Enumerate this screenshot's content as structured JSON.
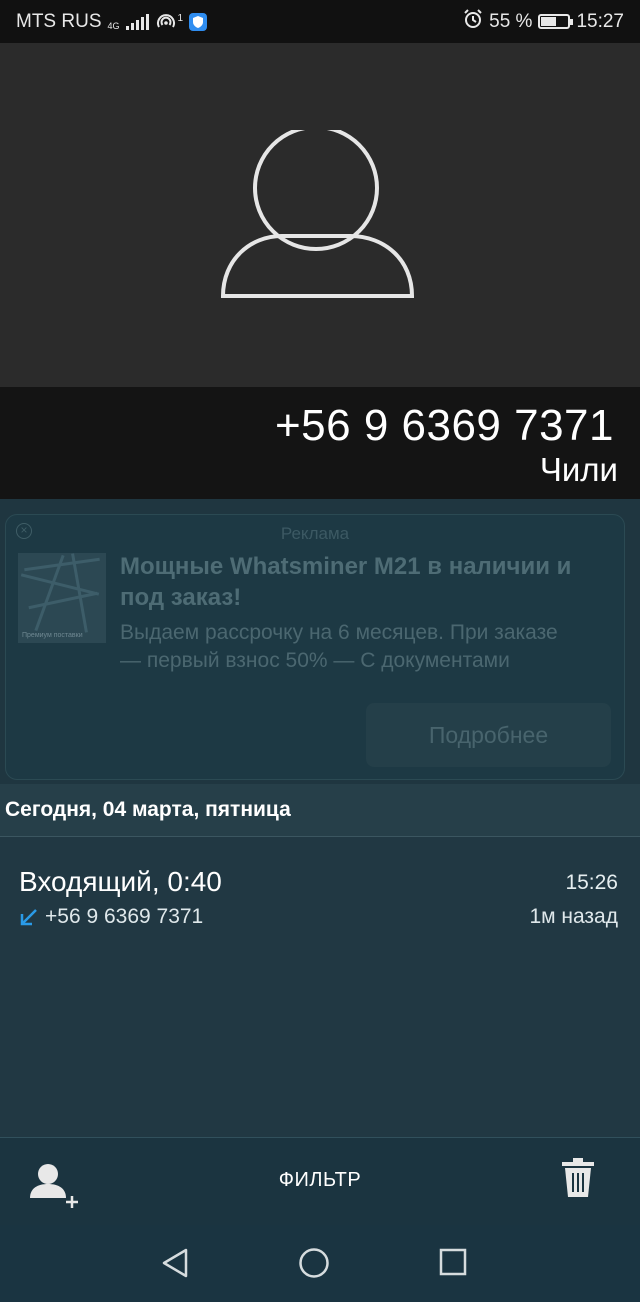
{
  "status_bar": {
    "carrier": "MTS RUS",
    "network": "4G",
    "hotspot_count": "1",
    "battery": "55 %",
    "battery_level": 0.55,
    "time": "15:27"
  },
  "contact": {
    "avatar_icon": "person-placeholder-icon",
    "phone": "+56 9 6369 7371",
    "location": "Чили"
  },
  "ad": {
    "label": "Реклама",
    "title": "Мощные Whatsminer M21 в наличии и под заказ!",
    "text": "Выдаем рассрочку на 6 месяцев. При заказе — первый взнос 50% — С документами",
    "image_caption": "Премиум поставки",
    "button": "Подробнее"
  },
  "call_log": {
    "date_header": "Сегодня, 04 марта, пятница",
    "entries": [
      {
        "type": "Входящий, 0:40",
        "number": "+56 9 6369 7371",
        "time": "15:26",
        "ago": "1м назад",
        "direction_icon": "incoming-call-arrow-icon",
        "accent": "#2a9be8"
      }
    ]
  },
  "toolbar": {
    "add_contact_icon": "add-contact-icon",
    "filter_label": "ФИЛЬТР",
    "delete_icon": "trash-icon"
  },
  "nav": {
    "back_icon": "back-triangle-icon",
    "home_icon": "home-circle-icon",
    "recents_icon": "recents-square-icon"
  }
}
